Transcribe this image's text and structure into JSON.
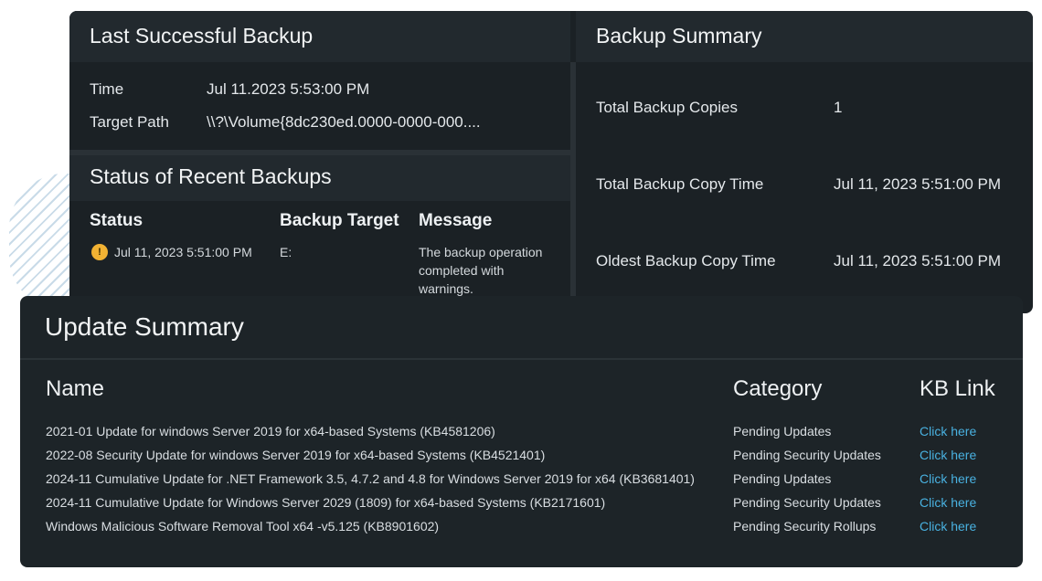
{
  "last_backup": {
    "title": "Last Successful Backup",
    "time_label": "Time",
    "time_value": "Jul 11.2023 5:53:00 PM",
    "path_label": "Target Path",
    "path_value": "\\\\?\\Volume{8dc230ed.0000-0000-000...."
  },
  "recent_backups": {
    "title": "Status of Recent Backups",
    "columns": [
      "Status",
      "Backup Target",
      "Message"
    ],
    "rows": [
      {
        "status_icon": "warning-icon",
        "status_date": "Jul 11, 2023 5:51:00 PM",
        "target": "E:",
        "message_lines": [
          "The backup operation",
          "completed with",
          "warnings."
        ]
      }
    ]
  },
  "backup_summary": {
    "title": "Backup  Summary",
    "items": [
      {
        "label": "Total Backup Copies",
        "value": "1"
      },
      {
        "label": "Total Backup Copy Time",
        "value": "Jul 11, 2023 5:51:00 PM"
      },
      {
        "label": "Oldest Backup Copy Time",
        "value": "Jul 11, 2023 5:51:00 PM"
      }
    ]
  },
  "update_summary": {
    "title": "Update Summary",
    "columns": {
      "name": "Name",
      "category": "Category",
      "kb_link": "KB Link"
    },
    "rows": [
      {
        "name": "2021-01 Update for windows Server 2019 for x64-based Systems (KB4581206)",
        "category": "Pending Updates",
        "link": "Click here"
      },
      {
        "name": "2022-08 Security Update for windows Server 2019 for x64-based Systems (KB4521401)",
        "category": "Pending Security Updates",
        "link": "Click here"
      },
      {
        "name": "2024-11 Cumulative Update for .NET Framework 3.5, 4.7.2 and 4.8 for Windows Server 2019 for x64 (KB3681401)",
        "category": "Pending Updates",
        "link": "Click here"
      },
      {
        "name": "2024-11 Cumulative Update for Windows Server 2029 (1809) for x64-based Systems (KB2171601)",
        "category": "Pending Security Updates",
        "link": "Click here"
      },
      {
        "name": "Windows Malicious Software Removal Tool x64 -v5.125 (KB8901602)",
        "category": "Pending Security Rollups",
        "link": "Click here"
      }
    ]
  },
  "colors": {
    "card_bg": "#1b2125",
    "header_bg": "#22292e",
    "link": "#49b1e0",
    "warning": "#f2b233"
  }
}
